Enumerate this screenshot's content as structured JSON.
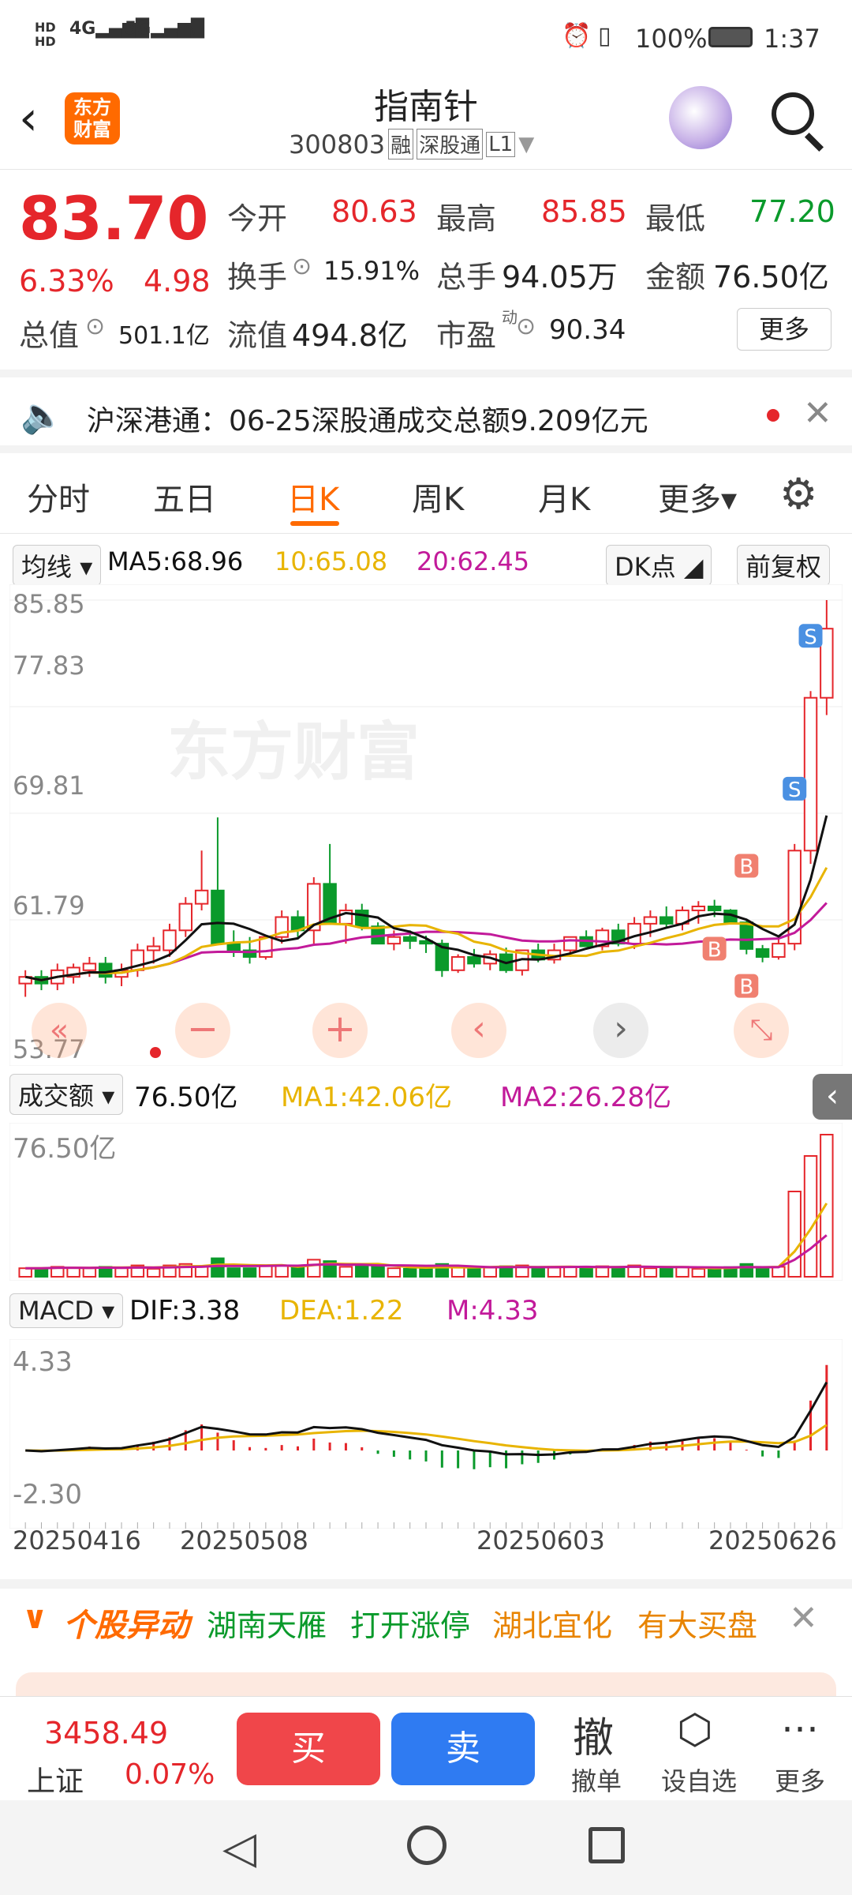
{
  "status": {
    "left_icons": "HD 4G 5G signal wifi",
    "alarm_icon": "alarm-icon",
    "battery_pct": "100%",
    "time": "1:37"
  },
  "header": {
    "title": "指南针",
    "code": "300803",
    "tag_margin": "融",
    "tag_connect": "深股通",
    "tag_level": "L1",
    "logo_text": "东方财富"
  },
  "quote": {
    "price": "83.70",
    "change_pct": "6.33%",
    "change": "4.98",
    "open_label": "今开",
    "open": "80.63",
    "high_label": "最高",
    "high": "85.85",
    "low_label": "最低",
    "low": "77.20",
    "turnover_label": "换手",
    "turnover": "15.91%",
    "volume_label": "总手",
    "volume": "94.05万",
    "amount_label": "金额",
    "amount": "76.50亿",
    "mcap_label": "总值",
    "mcap": "501.1亿",
    "float_label": "流值",
    "float": "494.8亿",
    "pe_label": "市盈",
    "pe_sup": "动",
    "pe": "90.34",
    "more": "更多"
  },
  "notice": {
    "text": "沪深港通：06-25深股通成交总额9.209亿元"
  },
  "tabs": [
    {
      "label": "分时"
    },
    {
      "label": "五日"
    },
    {
      "label": "日K",
      "active": true
    },
    {
      "label": "周K"
    },
    {
      "label": "月K"
    },
    {
      "label": "更多▾"
    }
  ],
  "ma_bar": {
    "select": "均线",
    "ma5": "MA5:68.96",
    "ma10": "10:65.08",
    "ma20": "20:62.45",
    "dk": "DK点",
    "fq": "前复权"
  },
  "kline_axis": {
    "p1": "85.85",
    "p2": "77.83",
    "p3": "69.81",
    "p4": "61.79",
    "p5": "53.77"
  },
  "watermark": "东方财富",
  "vol_bar": {
    "select": "成交额",
    "val": "76.50亿",
    "ma1": "MA1:42.06亿",
    "ma2": "MA2:26.28亿",
    "axis": "76.50亿"
  },
  "macd_bar": {
    "select": "MACD",
    "dif": "DIF:3.38",
    "dea": "DEA:1.22",
    "m": "M:4.33",
    "axis_top": "4.33",
    "axis_bottom": "-2.30"
  },
  "dates": {
    "d1": "20250416",
    "d2": "20250508",
    "d3": "20250603",
    "d4": "20250626"
  },
  "markers": {
    "b": "B",
    "s": "S"
  },
  "news": {
    "title": "个股异动",
    "item1": "湖南天雁",
    "item2": "打开涨停",
    "item3": "湖北宜化",
    "item4": "有大买盘"
  },
  "bottom": {
    "index_val": "3458.49",
    "index_name": "上证",
    "index_pct": "0.07%",
    "buy": "买",
    "sell": "卖",
    "cancel_glyph": "撤",
    "cancel": "撤单",
    "fav": "设自选",
    "more": "更多"
  },
  "colors": {
    "up": "#e5262b",
    "down": "#0a9a2b",
    "ma5": "#111111",
    "ma10": "#e8b400",
    "ma20": "#c21a9a",
    "accent": "#ff6a00"
  },
  "chart_data": {
    "type": "candlestick",
    "ylim": [
      53.77,
      85.85
    ],
    "dates_shown": [
      "20250416",
      "20250508",
      "20250603",
      "20250626"
    ],
    "candles": [
      [
        57,
        58,
        56,
        57.5
      ],
      [
        57.5,
        58,
        56.5,
        57
      ],
      [
        57,
        58.5,
        56.5,
        58
      ],
      [
        57.5,
        58.5,
        57,
        58.2
      ],
      [
        58,
        59,
        57.5,
        58.5
      ],
      [
        58.5,
        59,
        57,
        57.5
      ],
      [
        57.5,
        58.5,
        56.8,
        58
      ],
      [
        58,
        60,
        57.5,
        59.5
      ],
      [
        59.5,
        60.5,
        58.5,
        59.8
      ],
      [
        59.5,
        61.5,
        59,
        61
      ],
      [
        61,
        63.5,
        60.5,
        63
      ],
      [
        63,
        67,
        62.5,
        64
      ],
      [
        64,
        69.5,
        60,
        60
      ],
      [
        60,
        61,
        59,
        59.5
      ],
      [
        59.5,
        60.5,
        58.5,
        59
      ],
      [
        59,
        60.5,
        58.8,
        60.5
      ],
      [
        60.5,
        62.5,
        60,
        62
      ],
      [
        62,
        62.5,
        60.5,
        61
      ],
      [
        61,
        65,
        60,
        64.5
      ],
      [
        64.5,
        67.5,
        62,
        61.5
      ],
      [
        61.5,
        63,
        60,
        62.5
      ],
      [
        62.5,
        63,
        61,
        61.3
      ],
      [
        61.3,
        61.6,
        60,
        60
      ],
      [
        60,
        61,
        59.5,
        60.5
      ],
      [
        60.5,
        61,
        59.6,
        60.2
      ],
      [
        60.2,
        60.6,
        59.3,
        60
      ],
      [
        60,
        60.3,
        57.5,
        58
      ],
      [
        58,
        59.2,
        57.8,
        59
      ],
      [
        59,
        59.6,
        58.2,
        58.5
      ],
      [
        58.5,
        59.5,
        58,
        59.2
      ],
      [
        59.2,
        59.7,
        57.8,
        58
      ],
      [
        58,
        59.5,
        57.6,
        59.5
      ],
      [
        59.5,
        60,
        58.6,
        58.8
      ],
      [
        58.8,
        60,
        58.5,
        59.5
      ],
      [
        59.5,
        60.5,
        59,
        60.5
      ],
      [
        60.5,
        61,
        59.8,
        59.8
      ],
      [
        59.8,
        61.2,
        59.5,
        61
      ],
      [
        61,
        61.5,
        59.8,
        60
      ],
      [
        60,
        62,
        59.6,
        61.5
      ],
      [
        61.5,
        62.5,
        60.5,
        62
      ],
      [
        62,
        62.8,
        61.2,
        61.5
      ],
      [
        61.5,
        62.8,
        61,
        62.5
      ],
      [
        62.5,
        63.2,
        61.5,
        62.8
      ],
      [
        62.8,
        63.3,
        62,
        62.5
      ],
      [
        62.5,
        62.6,
        61.5,
        61.6
      ],
      [
        61.6,
        61.7,
        59.2,
        59.6
      ],
      [
        59.6,
        59.9,
        58.6,
        59
      ],
      [
        59,
        60.5,
        58.8,
        60
      ],
      [
        60,
        67.5,
        59.5,
        67
      ],
      [
        67,
        79,
        66,
        78.5
      ],
      [
        78.5,
        85.85,
        77.2,
        83.7
      ]
    ]
  }
}
